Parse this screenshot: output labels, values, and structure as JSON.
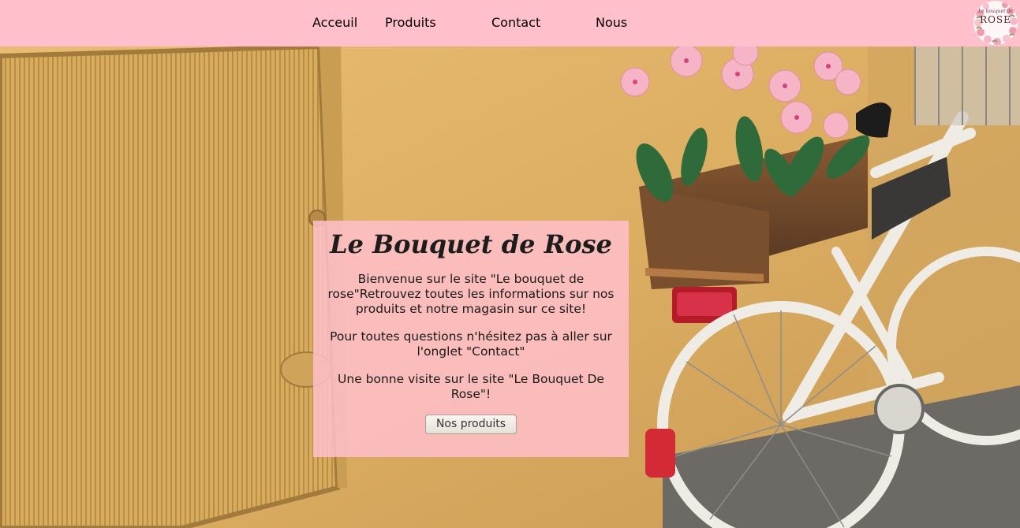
{
  "nav": {
    "items": [
      {
        "label": "Acceuil"
      },
      {
        "label": "Produits"
      },
      {
        "label": "Contact"
      },
      {
        "label": "Nous"
      }
    ]
  },
  "logo": {
    "line1": "Le bouquet de",
    "line2": "ROSE"
  },
  "hero": {
    "title": "Le Bouquet de Rose",
    "paragraphs": [
      "Bienvenue sur le site \"Le bouquet de rose\"Retrouvez toutes les informations sur nos produits et notre magasin sur ce site!",
      "Pour toutes questions n'hésitez pas à aller sur l'onglet \"Contact\"",
      "Une bonne visite sur le site \"Le Bouquet De Rose\"!"
    ],
    "button_label": "Nos produits"
  },
  "colors": {
    "navbar": "#ffc0cb",
    "card": "#ffc0cb",
    "wall": "#e2b468"
  }
}
